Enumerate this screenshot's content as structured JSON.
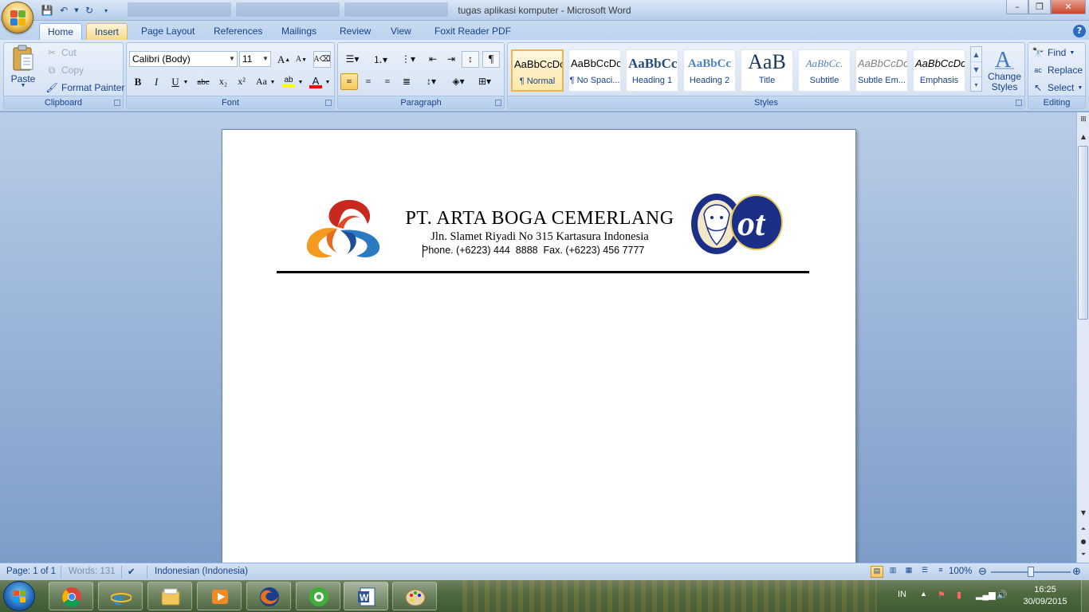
{
  "window": {
    "title": "tugas aplikasi komputer - Microsoft Word",
    "controls": {
      "minimize": "–",
      "restore": "❐",
      "close": "✕"
    }
  },
  "ribbon": {
    "tabs": [
      "Home",
      "Insert",
      "Page Layout",
      "References",
      "Mailings",
      "Review",
      "View",
      "Foxit Reader PDF"
    ],
    "clipboard": {
      "label": "Clipboard",
      "paste": "Paste",
      "cut": "Cut",
      "copy": "Copy",
      "format_painter": "Format Painter"
    },
    "font": {
      "label": "Font",
      "font_name": "Calibri (Body)",
      "font_size": "11",
      "bold": "B",
      "italic": "I",
      "underline": "U",
      "strike": "abc",
      "subscript": "x₂",
      "superscript": "x²",
      "change_case": "Aa",
      "grow": "A",
      "shrink": "A"
    },
    "paragraph": {
      "label": "Paragraph"
    },
    "styles": {
      "label": "Styles",
      "items": [
        {
          "sample": "AaBbCcDc",
          "name": "¶ Normal"
        },
        {
          "sample": "AaBbCcDc",
          "name": "¶ No Spaci..."
        },
        {
          "sample": "AaBbCc",
          "name": "Heading 1"
        },
        {
          "sample": "AaBbCc",
          "name": "Heading 2"
        },
        {
          "sample": "AaB",
          "name": "Title"
        },
        {
          "sample": "AaBbCc.",
          "name": "Subtitle"
        },
        {
          "sample": "AaBbCcDc",
          "name": "Subtle Em..."
        },
        {
          "sample": "AaBbCcDc",
          "name": "Emphasis"
        }
      ],
      "change_styles": "Change Styles"
    },
    "editing": {
      "label": "Editing",
      "find": "Find",
      "replace": "Replace",
      "select": "Select"
    }
  },
  "document": {
    "company": "PT. ARTA BOGA CEMERLANG",
    "address": "Jln. Slamet Riyadi No 315 Kartasura Indonesia",
    "phone": "Phone. (+6223) 444  8888  Fax. (+6223) 456 7777"
  },
  "statusbar": {
    "page": "Page: 1 of 1",
    "words": "Words: 131",
    "language": "Indonesian (Indonesia)",
    "zoom": "100%"
  },
  "taskbar": {
    "language": "IN",
    "time": "16:25",
    "date": "30/09/2015"
  },
  "colors": {
    "ribbon_text": "#15428b",
    "highlight": "#ffff00",
    "font_color": "#ff0000"
  }
}
